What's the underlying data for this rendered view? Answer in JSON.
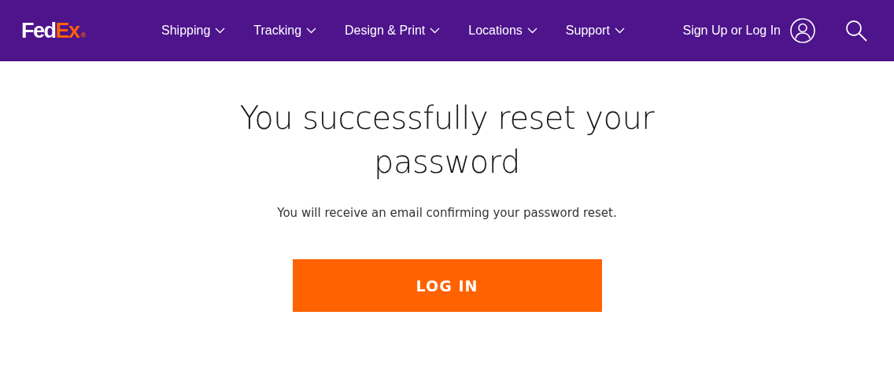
{
  "header": {
    "logo": {
      "first": "Fed",
      "second": "Ex",
      "mark": "®"
    },
    "nav": [
      {
        "label": "Shipping"
      },
      {
        "label": "Tracking"
      },
      {
        "label": "Design & Print"
      },
      {
        "label": "Locations"
      },
      {
        "label": "Support"
      }
    ],
    "account": {
      "label": "Sign Up or Log In"
    }
  },
  "main": {
    "title": "You successfully reset your password",
    "message": "You will receive an email confirming your password reset.",
    "button": "LOG IN"
  }
}
